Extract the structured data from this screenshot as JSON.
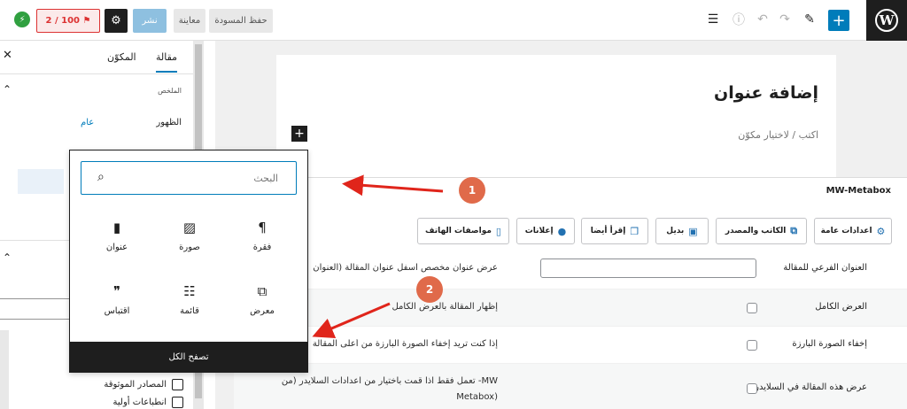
{
  "topbar": {
    "save_draft": "حفظ المسودة",
    "preview": "معاينة",
    "publish": "نشر",
    "seo_score": "2 / 100"
  },
  "sidebar": {
    "tab_post": "مقالة",
    "tab_block": "المكوّن",
    "summary_label": "الملخص",
    "visibility_label": "الظهور",
    "visibility_value": "عام",
    "checkbox_first_impressions": "انطباعات أولية",
    "checkbox_sources": "المصادر الموثوقة"
  },
  "editor": {
    "title": "إضافة عنوان",
    "placeholder": "اكتب / لاختيار مكوّن"
  },
  "inserter": {
    "search_placeholder": "البحث",
    "blocks": [
      {
        "label": "فقرة",
        "icon": "paragraph-icon"
      },
      {
        "label": "صورة",
        "icon": "image-icon"
      },
      {
        "label": "عنوان",
        "icon": "heading-icon"
      },
      {
        "label": "معرض",
        "icon": "gallery-icon"
      },
      {
        "label": "قائمة",
        "icon": "list-icon"
      },
      {
        "label": "اقتباس",
        "icon": "quote-icon"
      }
    ],
    "browse_all": "تصفح الكل"
  },
  "metabox": {
    "title": "MW-Metabox",
    "tabs": [
      {
        "label": "اعدادات عامة",
        "icon": "gear-icon"
      },
      {
        "label": "الكاتب والمصدر",
        "icon": "external-link-icon"
      },
      {
        "label": "بديل",
        "icon": "image-icon"
      },
      {
        "label": "إقرأ أيضا",
        "icon": "copy-icon"
      },
      {
        "label": "إعلانات",
        "icon": "lightbulb-icon"
      },
      {
        "label": "مواصفات الهاتف",
        "icon": "phone-icon"
      }
    ],
    "rows": [
      {
        "label": "العنوان الفرعي للمقالة",
        "desc": "عرض عنوان مخصص اسفل عنوان المقالة (العنوان"
      },
      {
        "label": "العرض الكامل",
        "desc": "إظهار المقالة بالعرض الكامل"
      },
      {
        "label": "إخفاء الصورة البارزة",
        "desc": "إذا كنت تريد إخفاء الصورة البارزة من أعلى المقالة"
      },
      {
        "label": "عرض هذه المقالة في السلايدر",
        "desc": "تعمل فقط اذا قمت باختيار من اعدادات السلايدر (من -MW",
        "desc2": "Metabox)"
      }
    ]
  },
  "annotations": [
    "1",
    "2"
  ],
  "colors": {
    "accent": "#007cba",
    "annotation": "#e06a4a",
    "arrow": "#e0251b"
  }
}
